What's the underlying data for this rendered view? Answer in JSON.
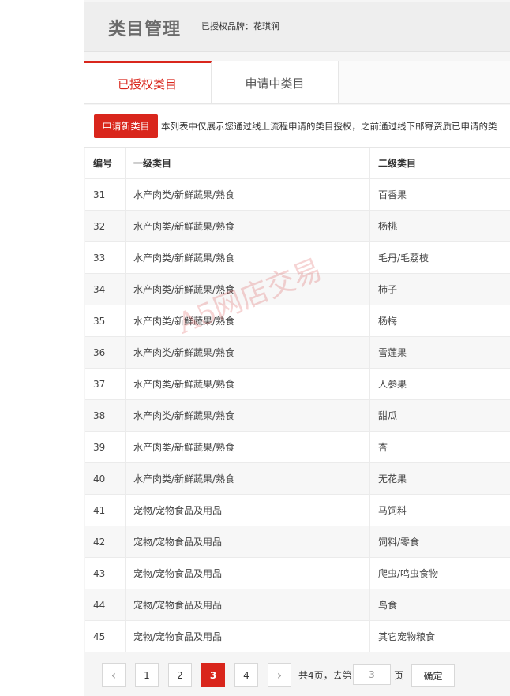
{
  "header": {
    "title": "类目管理",
    "brand_label": "已授权品牌：花琪涧"
  },
  "tabs": [
    {
      "label": "已授权类目",
      "active": true
    },
    {
      "label": "申请中类目",
      "active": false
    }
  ],
  "toolbar": {
    "new_button": "申请新类目",
    "notice": "本列表中仅展示您通过线上流程申请的类目授权，之前通过线下邮寄资质已申请的类"
  },
  "table": {
    "columns": [
      "编号",
      "一级类目",
      "二级类目"
    ],
    "rows": [
      [
        "31",
        "水产肉类/新鲜蔬果/熟食",
        "百香果"
      ],
      [
        "32",
        "水产肉类/新鲜蔬果/熟食",
        "杨桃"
      ],
      [
        "33",
        "水产肉类/新鲜蔬果/熟食",
        "毛丹/毛荔枝"
      ],
      [
        "34",
        "水产肉类/新鲜蔬果/熟食",
        "柿子"
      ],
      [
        "35",
        "水产肉类/新鲜蔬果/熟食",
        "杨梅"
      ],
      [
        "36",
        "水产肉类/新鲜蔬果/熟食",
        "雪莲果"
      ],
      [
        "37",
        "水产肉类/新鲜蔬果/熟食",
        "人参果"
      ],
      [
        "38",
        "水产肉类/新鲜蔬果/熟食",
        "甜瓜"
      ],
      [
        "39",
        "水产肉类/新鲜蔬果/熟食",
        "杏"
      ],
      [
        "40",
        "水产肉类/新鲜蔬果/熟食",
        "无花果"
      ],
      [
        "41",
        "宠物/宠物食品及用品",
        "马饲料"
      ],
      [
        "42",
        "宠物/宠物食品及用品",
        "饲料/零食"
      ],
      [
        "43",
        "宠物/宠物食品及用品",
        "爬虫/鸣虫食物"
      ],
      [
        "44",
        "宠物/宠物食品及用品",
        "鸟食"
      ],
      [
        "45",
        "宠物/宠物食品及用品",
        "其它宠物粮食"
      ]
    ]
  },
  "pagination": {
    "prev_icon": "‹",
    "next_icon": "›",
    "pages": [
      "1",
      "2",
      "3",
      "4"
    ],
    "current": "3",
    "total_text": "共4页，去第",
    "goto_value": "3",
    "page_suffix": "页",
    "confirm": "确定"
  },
  "watermark": "A5网店交易",
  "colors": {
    "accent": "#d9261c"
  }
}
